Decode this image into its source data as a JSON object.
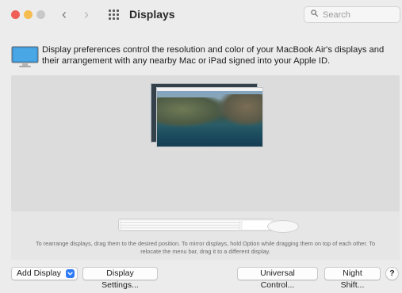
{
  "window": {
    "title": "Displays"
  },
  "search": {
    "placeholder": "Search"
  },
  "info": {
    "text": "Display preferences control the resolution and color of your MacBook Air's displays and their arrangement with any nearby Mac or iPad signed into your Apple ID."
  },
  "arrangement": {
    "hint": "To rearrange displays, drag them to the desired position. To mirror displays, hold Option while dragging them on top of each other. To relocate the menu bar, drag it to a different display."
  },
  "buttons": {
    "add_display": "Add Display",
    "display_settings": "Display Settings...",
    "universal_control": "Universal Control...",
    "night_shift": "Night Shift...",
    "help": "?"
  },
  "colors": {
    "close": "#ee5f57",
    "minimize": "#f5bd4f",
    "maximize": "#c8c8c8",
    "accent": "#2f7cf6"
  },
  "icons": {
    "back": "chevron-left-icon",
    "forward": "chevron-right-icon",
    "show_all": "grid-icon",
    "search": "search-icon",
    "display": "display-icon",
    "add_chevron": "chevron-down-icon",
    "keyboard": "keyboard-icon",
    "mouse": "mouse-icon"
  }
}
